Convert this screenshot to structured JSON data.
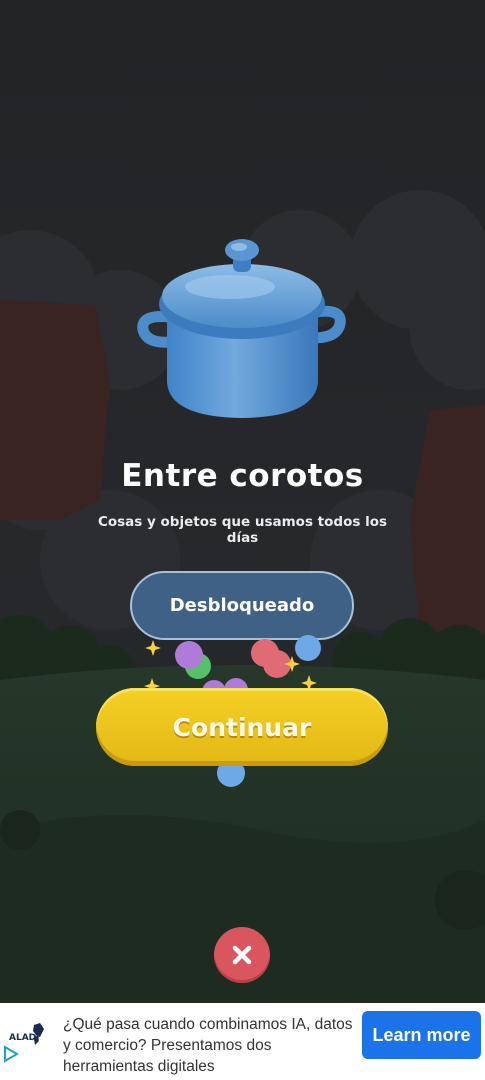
{
  "level": {
    "title": "Entre corotos",
    "subtitle": "Cosas y objetos que usamos todos los días",
    "status_label": "Desbloqueado",
    "image_icon": "cooking-pot-icon"
  },
  "actions": {
    "continue_label": "Continuar",
    "close_icon": "close-icon"
  },
  "ad": {
    "brand": "ALADI",
    "text": "¿Qué pasa cuando combinamos IA, datos y comercio? Presentamos dos herramientas digitales",
    "cta_label": "Learn more",
    "choices_icon": "ad-choices-icon"
  },
  "colors": {
    "status_pill": "#3f6186",
    "continue_button": "#f0c91f",
    "close_button": "#d9565f",
    "cta_button": "#1a73e8"
  }
}
